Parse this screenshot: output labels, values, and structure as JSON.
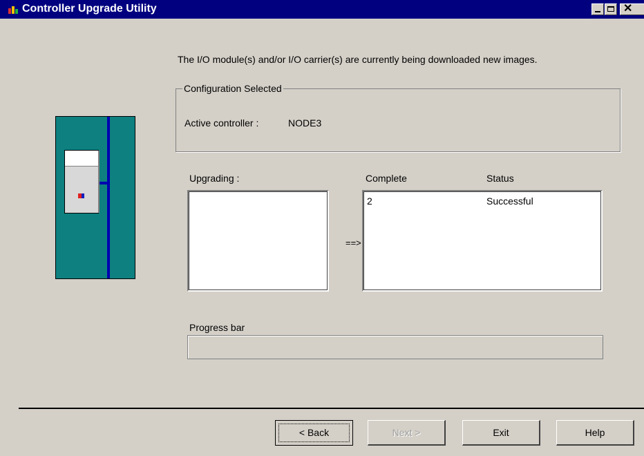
{
  "window": {
    "title": "Controller Upgrade Utility"
  },
  "message": "The I/O module(s) and/or I/O carrier(s) are currently being downloaded new images.",
  "config": {
    "legend": "Configuration Selected",
    "active_controller_label": "Active controller :",
    "active_controller_value": "NODE3"
  },
  "upgrading": {
    "label": "Upgrading :",
    "items": []
  },
  "arrow": "==>",
  "complete_list": {
    "headers": [
      "Complete",
      "Status"
    ],
    "rows": [
      {
        "complete": "2",
        "status": "Successful"
      }
    ]
  },
  "progress": {
    "label": "Progress bar",
    "value": 0
  },
  "buttons": {
    "back": "< Back",
    "next": "Next >",
    "exit": "Exit",
    "help": "Help"
  },
  "icons": {
    "app": "app-icon",
    "minimize": "minimize-icon",
    "maximize": "maximize-icon",
    "close": "close-icon"
  },
  "colors": {
    "titlebar": "#010180",
    "face": "#d4d0c8",
    "illustration_bg": "#0e8080"
  }
}
